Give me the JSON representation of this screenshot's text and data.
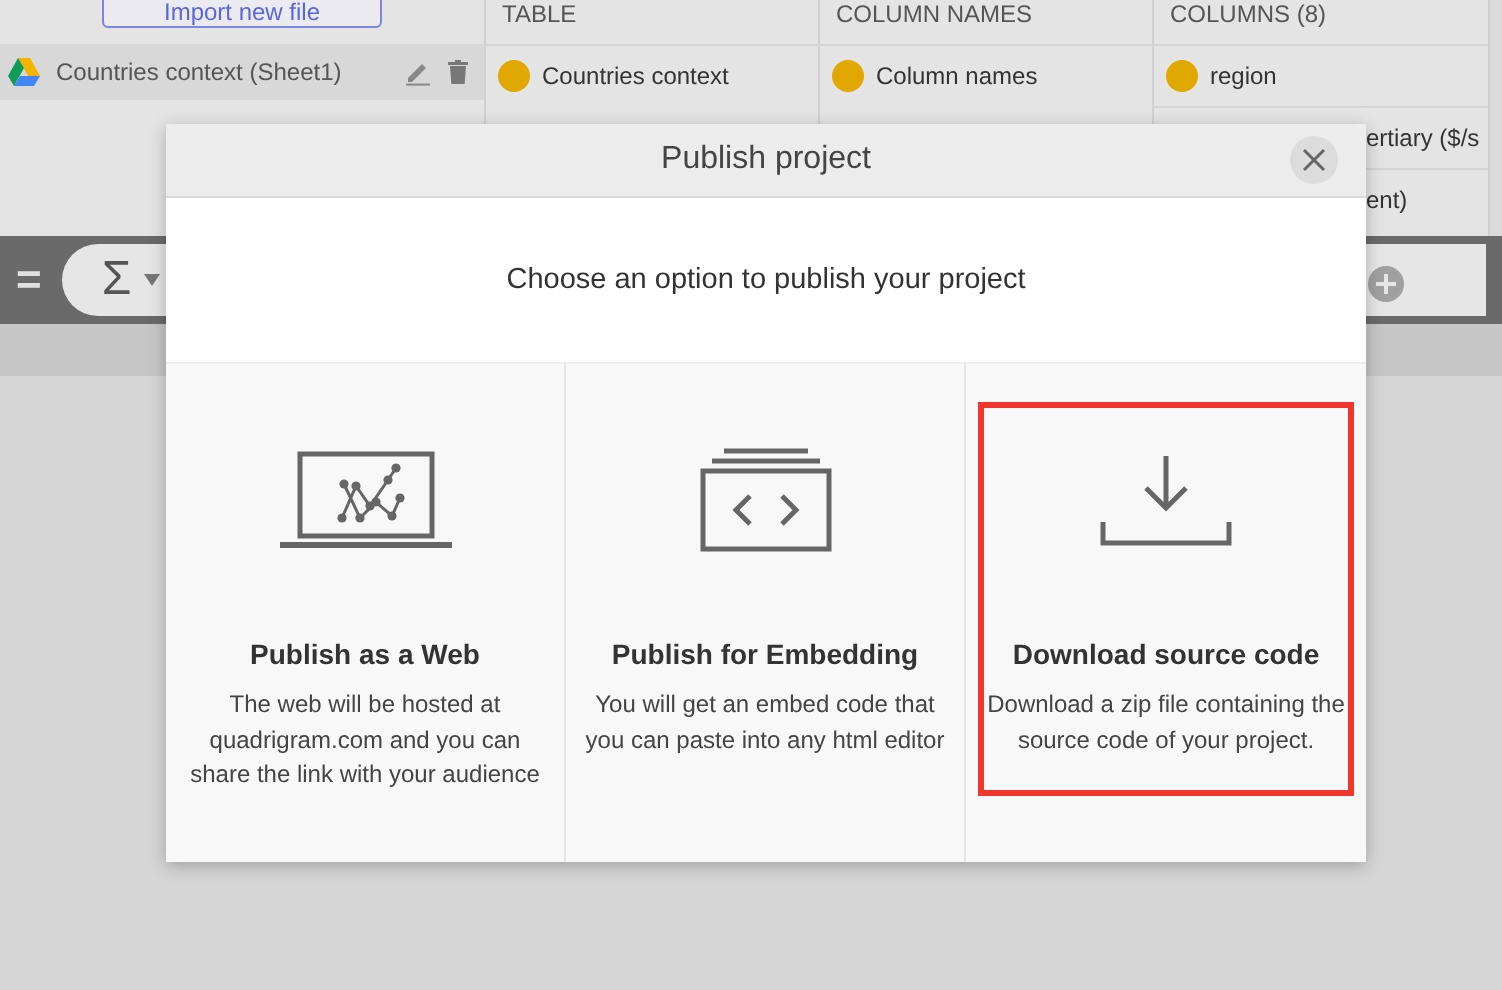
{
  "sources": {
    "import_button": "Import new file",
    "files": [
      {
        "name": "Countries context (Sheet1)",
        "selected": true
      }
    ]
  },
  "columns": [
    {
      "header": "TABLE",
      "items": [
        "Countries context"
      ]
    },
    {
      "header": "COLUMN NAMES",
      "items": [
        "Column names"
      ]
    },
    {
      "header": "COLUMNS (8)",
      "items": [
        "region",
        "ertiary ($/s",
        "ent)"
      ]
    }
  ],
  "formula_bar": {
    "operator": "=",
    "function_symbol": "Σ"
  },
  "dialog": {
    "title": "Publish project",
    "prompt": "Choose an option to publish your project",
    "options": [
      {
        "kind": "web",
        "title": "Publish as a Web",
        "description": "The web will be hosted at quadrigram.com and you can share the link with your audience",
        "selected": false
      },
      {
        "kind": "embed",
        "title": "Publish for Embedding",
        "description": "You will get an embed code that you can paste into any html editor",
        "selected": false
      },
      {
        "kind": "download",
        "title": "Download source code",
        "description": "Download a zip file containing the source code of your project.",
        "selected": true
      }
    ]
  }
}
